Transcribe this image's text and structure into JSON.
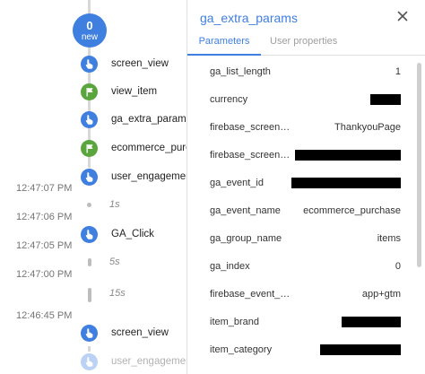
{
  "timeline": {
    "new_count": "0",
    "new_label": "new",
    "events": [
      {
        "label": "screen_view",
        "kind": "user"
      },
      {
        "label": "view_item",
        "kind": "conversion"
      },
      {
        "label": "ga_extra_params",
        "kind": "user"
      },
      {
        "label": "ecommerce_purchase",
        "kind": "conversion"
      },
      {
        "label": "user_engagement",
        "kind": "user"
      },
      {
        "label": "GA_Click",
        "kind": "user"
      },
      {
        "label": "screen_view",
        "kind": "user"
      },
      {
        "label": "user_engagement",
        "kind": "user"
      }
    ],
    "timestamps": [
      "12:47:07 PM",
      "12:47:06 PM",
      "12:47:05 PM",
      "12:47:00 PM",
      "12:46:45 PM"
    ],
    "gaps": [
      "1s",
      "5s",
      "15s"
    ]
  },
  "panel": {
    "title": "ga_extra_params",
    "tabs": [
      "Parameters",
      "User properties"
    ],
    "active_tab": "Parameters",
    "params": [
      {
        "key": "ga_list_length",
        "value": "1",
        "redacted": false
      },
      {
        "key": "currency",
        "value": "",
        "redacted": true
      },
      {
        "key": "firebase_screen_cl...",
        "value": "ThankyouPage",
        "redacted": false
      },
      {
        "key": "firebase_screen_id",
        "value": "",
        "redacted": true
      },
      {
        "key": "ga_event_id",
        "value": "",
        "redacted": true
      },
      {
        "key": "ga_event_name",
        "value": "ecommerce_purchase",
        "redacted": false
      },
      {
        "key": "ga_group_name",
        "value": "items",
        "redacted": false
      },
      {
        "key": "ga_index",
        "value": "0",
        "redacted": false
      },
      {
        "key": "firebase_event_ori...",
        "value": "app+gtm",
        "redacted": false
      },
      {
        "key": "item_brand",
        "value": "",
        "redacted": true
      },
      {
        "key": "item_category",
        "value": "",
        "redacted": true
      }
    ]
  },
  "colors": {
    "accent": "#3f7fe0",
    "user_event": "#3f7fe0",
    "conversion_event": "#5aa53e"
  },
  "icons": {
    "user_event": "user-touch-icon",
    "conversion_event": "flag-icon",
    "close": "close-icon"
  }
}
